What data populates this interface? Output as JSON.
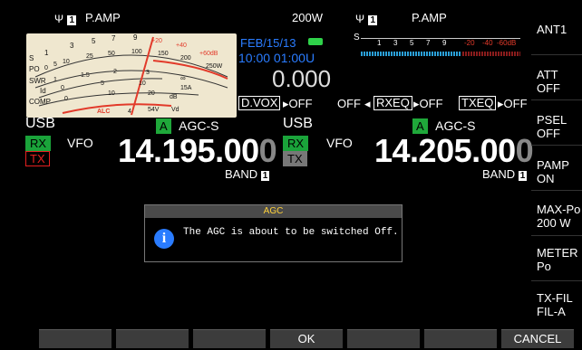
{
  "main": {
    "ant_label": "1",
    "preamp": "P.AMP",
    "power": "200W",
    "date": "FEB/15/13",
    "time": "10:00 01:00U",
    "value_readout": "0.000",
    "dvox": "D.VOX",
    "dvox_state": "OFF",
    "vfo_a": {
      "mode": "USB",
      "agc_tag": "A",
      "agc": "AGC-S",
      "rx": "RX",
      "tx": "TX",
      "vfo": "VFO",
      "freq_main": "14.195.00",
      "freq_last": "0",
      "band": "BAND",
      "band_num": "1"
    }
  },
  "sub": {
    "ant_label": "1",
    "preamp": "P.AMP",
    "s_label": "S",
    "scale": [
      "1",
      "3",
      "5",
      "7",
      "9",
      "-20",
      "-40",
      "-60dB"
    ],
    "off_label": "OFF",
    "rxeq": "RXEQ",
    "rxeq_state": "OFF",
    "txeq": "TXEQ",
    "txeq_state": "OFF",
    "vfo_b": {
      "mode": "USB",
      "agc_tag": "A",
      "agc": "AGC-S",
      "rx": "RX",
      "tx": "TX",
      "vfo": "VFO",
      "freq_main": "14.205.00",
      "freq_last": "0",
      "band": "BAND",
      "band_num": "1"
    }
  },
  "meter": {
    "s_scale": [
      "S",
      "1",
      "3",
      "5",
      "7",
      "9",
      "+20",
      "+40",
      "+60dB"
    ],
    "po_scale": [
      "PO",
      "0",
      "5",
      "10",
      "25",
      "50",
      "100",
      "150",
      "200",
      "250W"
    ],
    "swr_scale": [
      "SWR",
      "1",
      "1.5",
      "2",
      "3",
      "∞"
    ],
    "id_scale": [
      "Id",
      "0",
      "5",
      "10",
      "15A"
    ],
    "comp_scale": [
      "COMP",
      "0",
      "10",
      "20",
      "dB"
    ],
    "alc": "ALC",
    "vd_scale": [
      "4",
      "54V",
      "Vd"
    ]
  },
  "right_menu": [
    {
      "line1": "ANT1",
      "line2": ""
    },
    {
      "line1": "ATT",
      "line2": "OFF"
    },
    {
      "line1": "PSEL",
      "line2": "OFF"
    },
    {
      "line1": "PAMP",
      "line2": "ON"
    },
    {
      "line1": "MAX-Po",
      "line2": "200 W"
    },
    {
      "line1": "METER",
      "line2": "Po"
    },
    {
      "line1": "TX-FIL",
      "line2": "FIL-A"
    }
  ],
  "dialog": {
    "title": "AGC",
    "message": "The AGC is about to be switched Off."
  },
  "function_bar": {
    "ok": "OK",
    "cancel": "CANCEL"
  },
  "colors": {
    "accent_blue": "#2a7cff",
    "agc_green": "#1fa83a",
    "rx_green": "#1aa33a",
    "tx_red": "#e52020",
    "needle_red": "#e23a2a"
  }
}
